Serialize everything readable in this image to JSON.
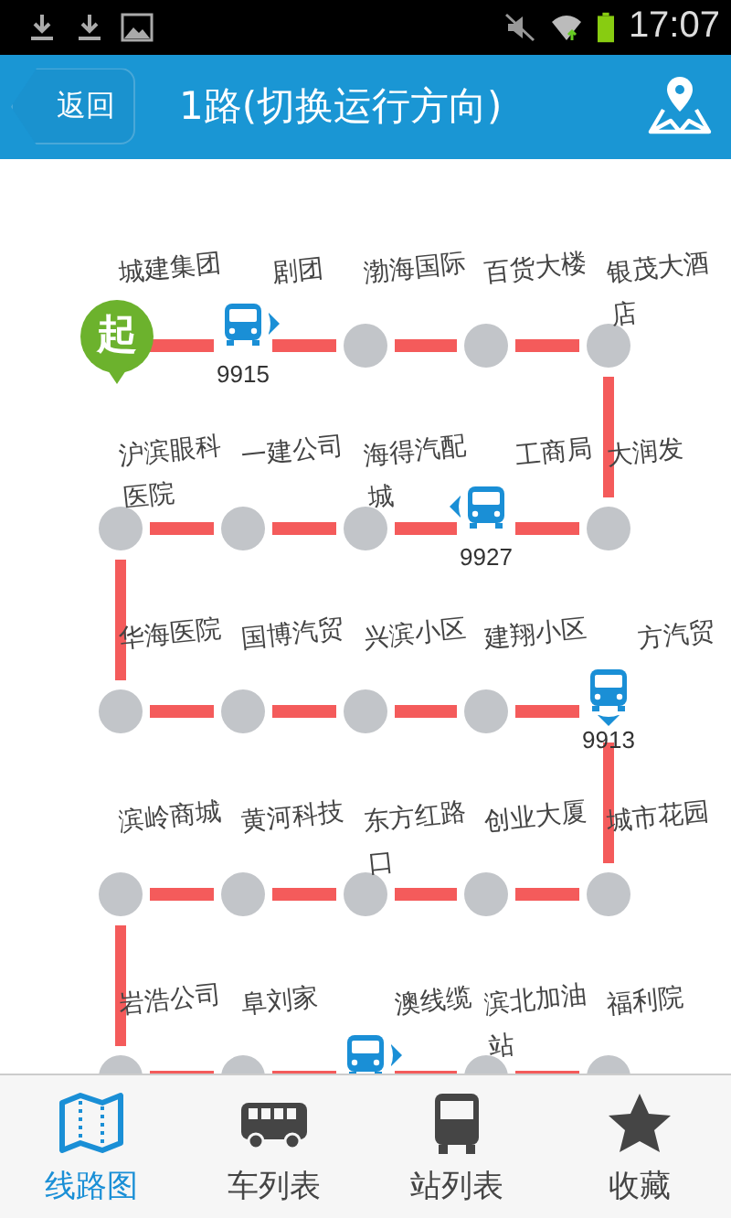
{
  "status_bar": {
    "time": "17:07"
  },
  "header": {
    "back": "返回",
    "title": "1路(切换运行方向)"
  },
  "stations": [
    {
      "name": "城建集团",
      "kind": "start",
      "marker": "起"
    },
    {
      "name": "剧团",
      "kind": "stop",
      "bus": {
        "number": "9915",
        "kind": "rightward"
      }
    },
    {
      "name": "渤海国际",
      "kind": "stop"
    },
    {
      "name": "百货大楼",
      "kind": "stop"
    },
    {
      "name": "银茂大酒店",
      "kind": "stop"
    },
    {
      "name": "大润发",
      "kind": "stop"
    },
    {
      "name": "工商局",
      "kind": "stop",
      "bus": {
        "number": "9927",
        "kind": "leftward"
      }
    },
    {
      "name": "海得汽配城",
      "kind": "stop"
    },
    {
      "name": "一建公司",
      "kind": "stop"
    },
    {
      "name": "沪滨眼科医院",
      "kind": "stop"
    },
    {
      "name": "华海医院",
      "kind": "stop"
    },
    {
      "name": "国博汽贸",
      "kind": "stop"
    },
    {
      "name": "兴滨小区",
      "kind": "stop"
    },
    {
      "name": "建翔小区",
      "kind": "stop"
    },
    {
      "name": "方汽贸",
      "kind": "stop",
      "bus": {
        "number": "9913",
        "kind": "downward"
      }
    },
    {
      "name": "城市花园",
      "kind": "stop"
    },
    {
      "name": "创业大厦",
      "kind": "stop"
    },
    {
      "name": "东方红路口",
      "kind": "stop"
    },
    {
      "name": "黄河科技",
      "kind": "stop"
    },
    {
      "name": "滨岭商城",
      "kind": "stop"
    },
    {
      "name": "岩浩公司",
      "kind": "stop"
    },
    {
      "name": "阜刘家",
      "kind": "stop"
    },
    {
      "name": "澳线缆",
      "kind": "stop",
      "bus": {
        "kind": "rightward"
      }
    },
    {
      "name": "滨北加油站",
      "kind": "stop"
    },
    {
      "name": "福利院",
      "kind": "stop"
    }
  ],
  "tabs": [
    {
      "label": "线路图",
      "kind": "map",
      "selected": true
    },
    {
      "label": "车列表",
      "kind": "bus",
      "selected": false
    },
    {
      "label": "站列表",
      "kind": "stop",
      "selected": false
    },
    {
      "label": "收藏",
      "kind": "star",
      "selected": false
    }
  ]
}
